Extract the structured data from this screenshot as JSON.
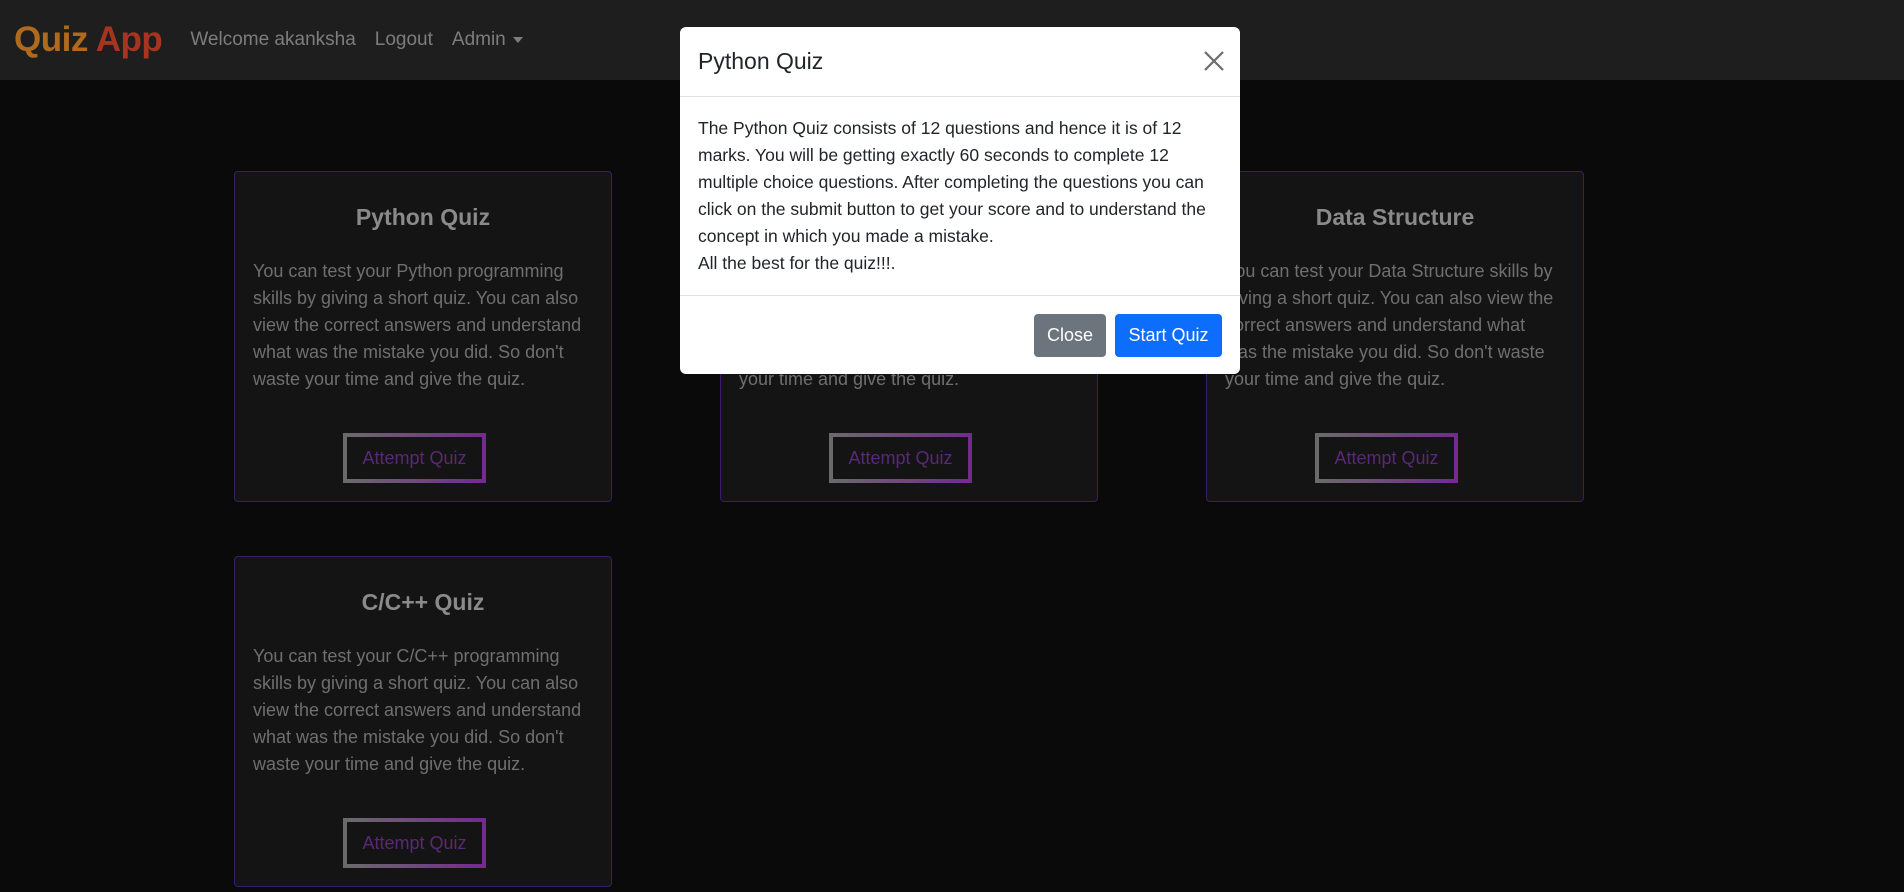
{
  "navbar": {
    "brand_part1": "Quiz",
    "brand_part2": "App",
    "welcome": "Welcome akanksha",
    "logout": "Logout",
    "admin": "Admin"
  },
  "cards": [
    {
      "title": "Python Quiz",
      "text": "You can test your Python programming skills by giving a short quiz. You can also view the correct answers and understand what was the mistake you did. So don't waste your time and give the quiz.",
      "button": "Attempt Quiz"
    },
    {
      "title": "",
      "text": "your time and give the quiz.",
      "button": "Attempt Quiz"
    },
    {
      "title": "Data Structure",
      "text": "You can test your Data Structure skills by giving a short quiz. You can also view the correct answers and understand what was the mistake you did. So don't waste your time and give the quiz.",
      "button": "Attempt Quiz"
    },
    {
      "title": "C/C++ Quiz",
      "text": "You can test your C/C++ programming skills by giving a short quiz. You can also view the correct answers and understand what was the mistake you did. So don't waste your time and give the quiz.",
      "button": "Attempt Quiz"
    }
  ],
  "modal": {
    "title": "Python Quiz",
    "body": "The Python Quiz consists of 12 questions and hence it is of 12 marks. You will be getting exactly 60 seconds to complete 12 multiple choice questions. After completing the questions you can click on the submit button to get your score and to understand the concept in which you made a mistake.",
    "body_line2": "All the best for the quiz!!!.",
    "close_label": "Close",
    "start_label": "Start Quiz"
  },
  "colors": {
    "navbar_bg": "#1e1e1e",
    "brand_quiz": "#b06a1e",
    "brand_app": "#a7341e",
    "card_border": "#3e1a6e",
    "btn_secondary": "#6c757d",
    "btn_primary": "#0d6efd"
  },
  "icons": {
    "close": "close-icon",
    "dropdown": "caret-down-icon"
  }
}
